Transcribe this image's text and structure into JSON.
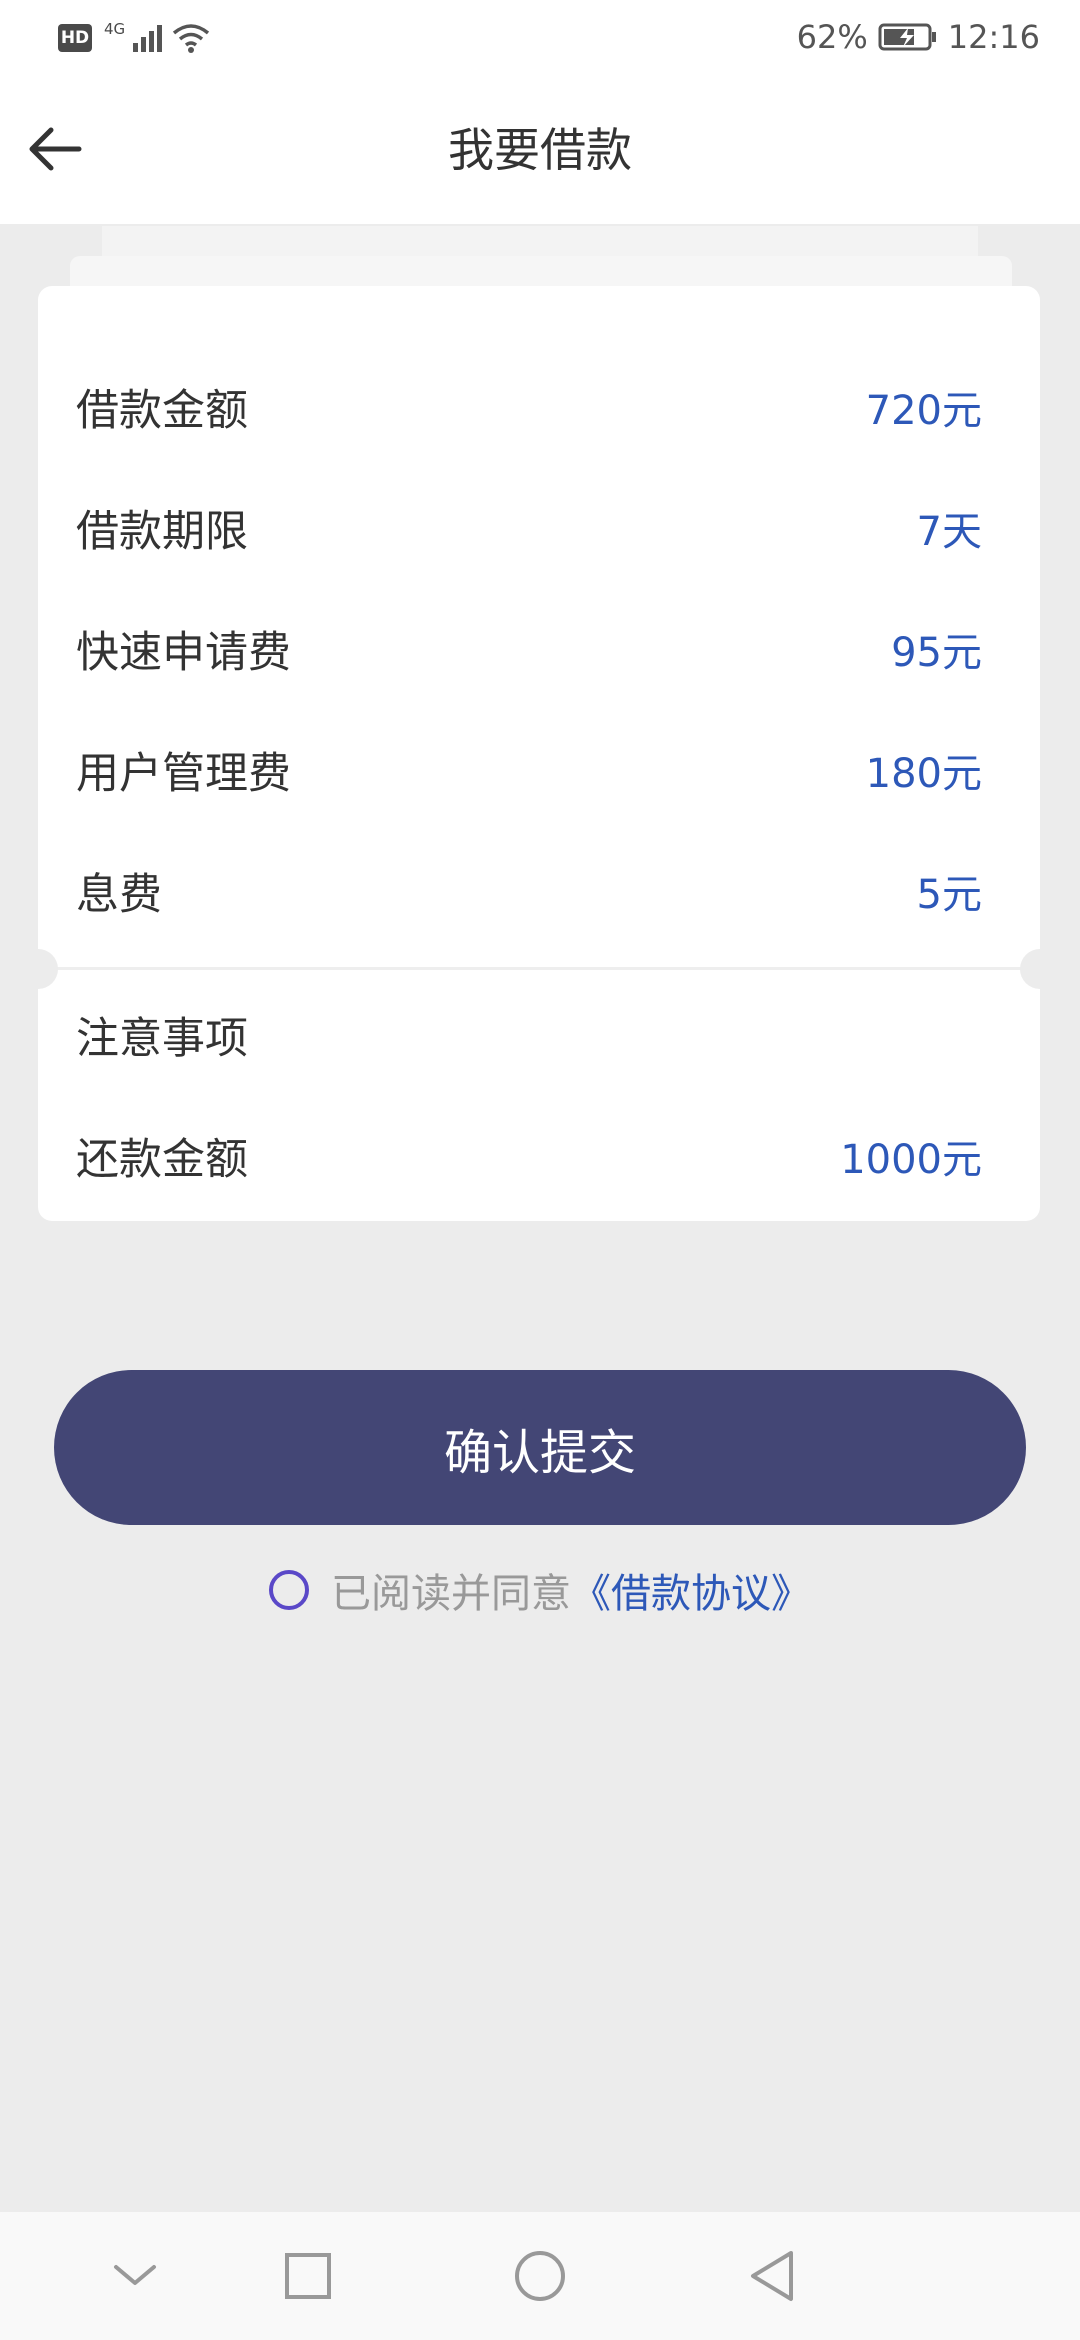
{
  "status_bar": {
    "hd": "HD",
    "network": "4G",
    "battery_percent": "62%",
    "time": "12:16"
  },
  "header": {
    "title": "我要借款"
  },
  "details": [
    {
      "label": "借款金额",
      "value": "720元"
    },
    {
      "label": "借款期限",
      "value": "7天"
    },
    {
      "label": "快速申请费",
      "value": "95元"
    },
    {
      "label": "用户管理费",
      "value": "180元"
    },
    {
      "label": "息费",
      "value": "5元"
    }
  ],
  "notice": {
    "label": "注意事项"
  },
  "repayment": {
    "label": "还款金额",
    "value": "1000元"
  },
  "submit_label": "确认提交",
  "agreement": {
    "text": "已阅读并同意",
    "link": "《借款协议》",
    "checked": false
  },
  "colors": {
    "accent": "#2d58b8",
    "button": "#434675",
    "background": "#ececec"
  }
}
